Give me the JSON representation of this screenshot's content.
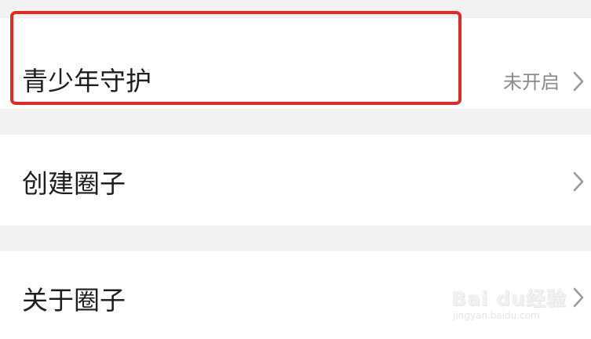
{
  "settings": {
    "items": [
      {
        "label": "青少年守护",
        "value": "未开启"
      },
      {
        "label": "创建圈子"
      },
      {
        "label": "关于圈子"
      }
    ]
  },
  "highlight": {
    "color": "#e02a24"
  },
  "watermark": {
    "brand": "Bai du经验",
    "url": "jingyan.baidu.com"
  },
  "icons": {
    "chevron": "chevron-right-icon"
  }
}
